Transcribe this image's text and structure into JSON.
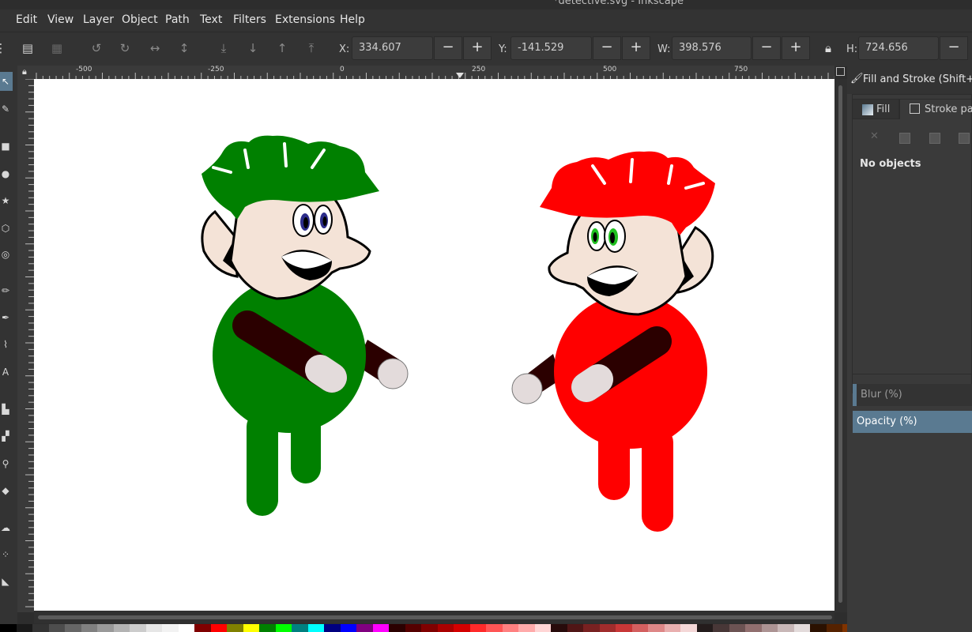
{
  "window": {
    "title": "*detective.svg - Inkscape"
  },
  "menu": [
    "Edit",
    "View",
    "Layer",
    "Object",
    "Path",
    "Text",
    "Filters",
    "Extensions",
    "Help"
  ],
  "toolbar": {
    "x_label": "X:",
    "x_value": "334.607",
    "y_label": "Y:",
    "y_value": "-141.529",
    "w_label": "W:",
    "w_value": "398.576",
    "h_label": "H:",
    "h_value": "724.656",
    "minus": "−",
    "plus": "+"
  },
  "ruler": {
    "top_ticks": [
      "-500",
      "-250",
      "0",
      "250",
      "500",
      "750"
    ]
  },
  "panel": {
    "title": "Fill and Stroke (Shift+C)",
    "tab_fill": "Fill",
    "tab_stroke": "Stroke paint",
    "status": "No objects",
    "blur_label": "Blur (%)",
    "opacity_label": "Opacity (%)"
  },
  "colors": {
    "green_character": "#008000",
    "red_character": "#ff0000",
    "skin": "#f4e3d7",
    "sleeve": "#2b0000",
    "hand": "#e3dbdb",
    "accent": "#5a7a91"
  },
  "palette": [
    "#000000",
    "#1a1a1a",
    "#333333",
    "#4d4d4d",
    "#666666",
    "#808080",
    "#999999",
    "#b3b3b3",
    "#cccccc",
    "#e6e6e6",
    "#f2f2f2",
    "#ffffff",
    "#800000",
    "#ff0000",
    "#808000",
    "#ffff00",
    "#008000",
    "#00ff00",
    "#008080",
    "#00ffff",
    "#000080",
    "#0000ff",
    "#800080",
    "#ff00ff",
    "#2b0000",
    "#550000",
    "#800000",
    "#aa0000",
    "#d40000",
    "#ff2a2a",
    "#ff5555",
    "#ff8080",
    "#ffaaaa",
    "#ffd5d5",
    "#280b0b",
    "#501616",
    "#782121",
    "#a02c2c",
    "#c83737",
    "#d35f5f",
    "#de8787",
    "#e9afaf",
    "#f4d7d7",
    "#241c1c",
    "#483737",
    "#6c5353",
    "#916f6f",
    "#ac9393",
    "#c8b7b7",
    "#e3dbdb",
    "#2b1100",
    "#552200",
    "#803300",
    "#aa4400",
    "#d45500",
    "#ff6600",
    "#ff7f2a",
    "#ff9955",
    "#ffb380",
    "#ffccaa"
  ]
}
